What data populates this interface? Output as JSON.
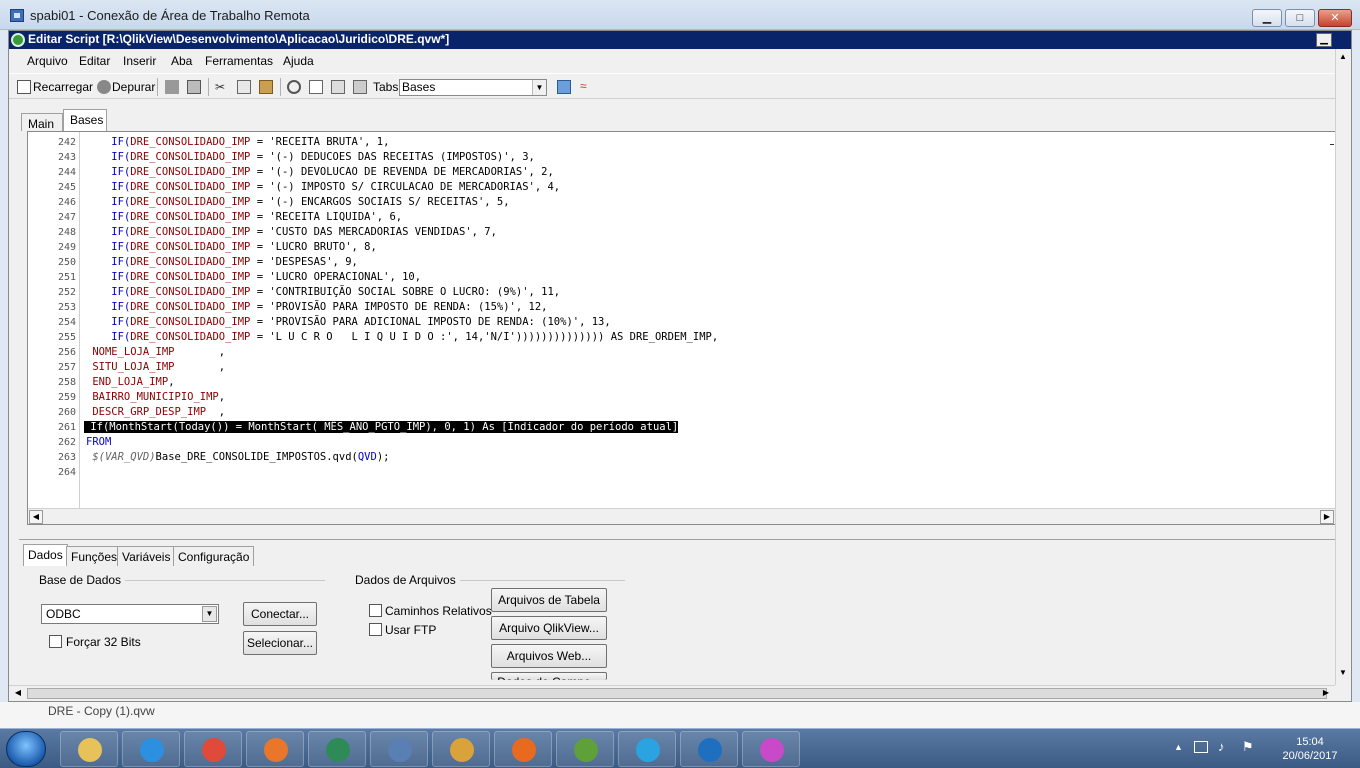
{
  "rdp": {
    "title": "spabi01 - Conexão de Área de Trabalho Remota",
    "min": "▁",
    "max": "□",
    "close": "✕"
  },
  "qv": {
    "title": "Editar Script [R:\\QlikView\\Desenvolvimento\\Aplicacao\\Juridico\\DRE.qvw*]",
    "min": "▁"
  },
  "menu": [
    "Arquivo",
    "Editar",
    "Inserir",
    "Aba",
    "Ferramentas",
    "Ajuda"
  ],
  "toolbar": {
    "reload": "Recarregar",
    "debug": "Depurar",
    "tabs_label": "Tabs",
    "tabs_value": "Bases"
  },
  "script_tabs": [
    "Main",
    "Bases"
  ],
  "editor": {
    "lines": [
      {
        "n": "242",
        "pre": "    ",
        "fn": "IF(",
        "field": "DRE_CONSOLIDADO_IMP",
        "rest": " = 'RECEITA BRUTA', 1,"
      },
      {
        "n": "243",
        "pre": "    ",
        "fn": "IF(",
        "field": "DRE_CONSOLIDADO_IMP",
        "rest": " = '(-) DEDUCOES DAS RECEITAS (IMPOSTOS)', 3,"
      },
      {
        "n": "244",
        "pre": "    ",
        "fn": "IF(",
        "field": "DRE_CONSOLIDADO_IMP",
        "rest": " = '(-) DEVOLUCAO DE REVENDA DE MERCADORIAS', 2,"
      },
      {
        "n": "245",
        "pre": "    ",
        "fn": "IF(",
        "field": "DRE_CONSOLIDADO_IMP",
        "rest": " = '(-) IMPOSTO S/ CIRCULACAO DE MERCADORIAS', 4,"
      },
      {
        "n": "246",
        "pre": "    ",
        "fn": "IF(",
        "field": "DRE_CONSOLIDADO_IMP",
        "rest": " = '(-) ENCARGOS SOCIAIS S/ RECEITAS', 5,"
      },
      {
        "n": "247",
        "pre": "    ",
        "fn": "IF(",
        "field": "DRE_CONSOLIDADO_IMP",
        "rest": " = 'RECEITA LIQUIDA', 6,"
      },
      {
        "n": "248",
        "pre": "    ",
        "fn": "IF(",
        "field": "DRE_CONSOLIDADO_IMP",
        "rest": " = 'CUSTO DAS MERCADORIAS VENDIDAS', 7,"
      },
      {
        "n": "249",
        "pre": "    ",
        "fn": "IF(",
        "field": "DRE_CONSOLIDADO_IMP",
        "rest": " = 'LUCRO BRUTO', 8,"
      },
      {
        "n": "250",
        "pre": "    ",
        "fn": "IF(",
        "field": "DRE_CONSOLIDADO_IMP",
        "rest": " = 'DESPESAS', 9,"
      },
      {
        "n": "251",
        "pre": "    ",
        "fn": "IF(",
        "field": "DRE_CONSOLIDADO_IMP",
        "rest": " = 'LUCRO OPERACIONAL', 10,"
      },
      {
        "n": "252",
        "pre": "    ",
        "fn": "IF(",
        "field": "DRE_CONSOLIDADO_IMP",
        "rest": " = 'CONTRIBUIÇÃO SOCIAL SOBRE O LUCRO: (9%)', 11,"
      },
      {
        "n": "253",
        "pre": "    ",
        "fn": "IF(",
        "field": "DRE_CONSOLIDADO_IMP",
        "rest": " = 'PROVISÃO PARA IMPOSTO DE RENDA: (15%)', 12,"
      },
      {
        "n": "254",
        "pre": "    ",
        "fn": "IF(",
        "field": "DRE_CONSOLIDADO_IMP",
        "rest": " = 'PROVISÃO PARA ADICIONAL IMPOSTO DE RENDA: (10%)', 13,"
      },
      {
        "n": "255",
        "pre": "    ",
        "fn": "IF(",
        "field": "DRE_CONSOLIDADO_IMP",
        "rest": " = 'L U C R O   L I Q U I D O :', 14,'N/I')))))))))))))) AS DRE_ORDEM_IMP,"
      },
      {
        "n": "256",
        "pre": " ",
        "fn": "",
        "field": "NOME_LOJA_IMP",
        "rest": "       ,"
      },
      {
        "n": "257",
        "pre": " ",
        "fn": "",
        "field": "SITU_LOJA_IMP",
        "rest": "       ,"
      },
      {
        "n": "258",
        "pre": " ",
        "fn": "",
        "field": "END_LOJA_IMP",
        "rest": ","
      },
      {
        "n": "259",
        "pre": " ",
        "fn": "",
        "field": "BAIRRO_MUNICIPIO_IMP",
        "rest": ","
      },
      {
        "n": "260",
        "pre": " ",
        "fn": "",
        "field": "DESCR_GRP_DESP_IMP",
        "rest": "  ,"
      },
      {
        "n": "261",
        "pre": "",
        "fn": "",
        "field": "",
        "rest": " If(MonthStart(Today()) = MonthStart( MÊS_ANO_PGTO_IMP), 0, 1) As [Indicador do período atual]",
        "highlight": true
      },
      {
        "n": "262",
        "pre": "",
        "fn": "",
        "field": "",
        "rest": "",
        "kw": "FROM"
      },
      {
        "n": "263",
        "pre": " ",
        "fn": "",
        "field": "",
        "rest": "Base_DRE_CONSOLIDE_IMPOSTOS.qvd(",
        "var": "$(VAR_QVD)",
        "tail_kw": "QVD",
        "tail": ");"
      },
      {
        "n": "264",
        "pre": "",
        "fn": "",
        "field": "",
        "rest": ""
      }
    ]
  },
  "bottom": {
    "tabs": [
      "Dados",
      "Funções",
      "Variáveis",
      "Configuração"
    ],
    "database_group": "Base de Dados",
    "database_value": "ODBC",
    "connect": "Conectar...",
    "select": "Selecionar...",
    "force32": "Forçar 32 Bits",
    "files_group": "Dados de Arquivos",
    "relative_paths": "Caminhos Relativos",
    "use_ftp": "Usar FTP",
    "table_files": "Arquivos de Tabela ...",
    "qlikview_file": "Arquivo QlikView...",
    "web_files": "Arquivos Web...",
    "field_data": "Dados do Campo..."
  },
  "strip": {
    "text": "DRE - Copy (1).qvw"
  },
  "taskbar": {
    "apps": [
      "file-explorer-icon",
      "internet-explorer-icon",
      "chrome-icon",
      "media-player-icon",
      "qlikview-icon",
      "remote-desktop-icon",
      "app-icon",
      "firefox-icon",
      "frog-app-icon",
      "telegram-icon",
      "outlook-icon",
      "paint-app-icon"
    ],
    "time": "15:04",
    "date": "20/06/2017"
  }
}
